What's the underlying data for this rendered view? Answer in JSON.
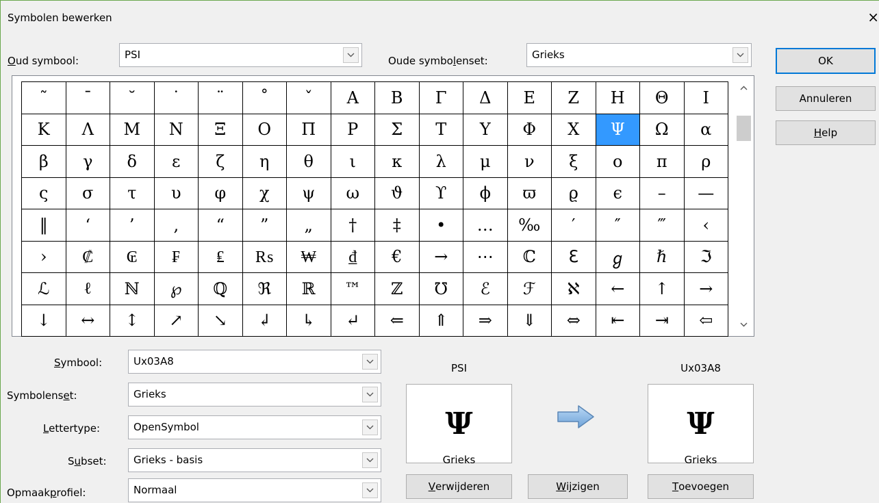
{
  "window": {
    "title": "Symbolen bewerken",
    "close_glyph": "×"
  },
  "old_symbol": {
    "label_u": "O",
    "label_rest": "ud symbool:",
    "value": "PSI"
  },
  "old_set": {
    "label_pre": "Oude symbo",
    "label_u": "l",
    "label_rest": "enset:",
    "value": "Grieks"
  },
  "buttons": {
    "ok": "OK",
    "cancel": "Annuleren",
    "help_u": "H",
    "help_rest": "elp",
    "delete_u": "V",
    "delete_rest": "erwijderen",
    "modify_u": "W",
    "modify_rest": "ijzigen",
    "add_u": "T",
    "add_rest": "oevoegen"
  },
  "grid": {
    "columns": 16,
    "selected_index": 29,
    "cells": [
      "˜",
      "¯",
      "˘",
      "˙",
      "¨",
      "˚",
      "ˇ",
      "Α",
      "Β",
      "Γ",
      "Δ",
      "Ε",
      "Ζ",
      "Η",
      "Θ",
      "Ι",
      "Κ",
      "Λ",
      "Μ",
      "Ν",
      "Ξ",
      "Ο",
      "Π",
      "Ρ",
      "Σ",
      "Τ",
      "Υ",
      "Φ",
      "Χ",
      "Ψ",
      "Ω",
      "α",
      "β",
      "γ",
      "δ",
      "ε",
      "ζ",
      "η",
      "θ",
      "ι",
      "κ",
      "λ",
      "μ",
      "ν",
      "ξ",
      "ο",
      "π",
      "ρ",
      "ς",
      "σ",
      "τ",
      "υ",
      "φ",
      "χ",
      "ψ",
      "ω",
      "ϑ",
      "ϒ",
      "ϕ",
      "ϖ",
      "ϱ",
      "ϵ",
      "–",
      "—",
      "‖",
      "‘",
      "’",
      "‚",
      "“",
      "”",
      "„",
      "†",
      "‡",
      "•",
      "…",
      "‰",
      "′",
      "″",
      "‴",
      "‹",
      "›",
      "₡",
      "₢",
      "₣",
      "₤",
      "₨",
      "₩",
      "₫",
      "€",
      "→",
      "⋯",
      "ℂ",
      "ℇ",
      "ℊ",
      "ℏ",
      "ℑ",
      "ℒ",
      "ℓ",
      "ℕ",
      "℘",
      "ℚ",
      "ℜ",
      "ℝ",
      "™",
      "ℤ",
      "℧",
      "ℰ",
      "ℱ",
      "ℵ",
      "←",
      "↑",
      "→",
      "↓",
      "↔",
      "↕",
      "↗",
      "↘",
      "↲",
      "↳",
      "↵",
      "⇐",
      "⇑",
      "⇒",
      "⇓",
      "⇔",
      "⇤",
      "⇥",
      "⇦"
    ]
  },
  "fields": {
    "symbol": {
      "label_u": "S",
      "label_rest": "ymbool:",
      "value": "Ux03A8"
    },
    "symbolset": {
      "label_pre": "Symbolens",
      "label_u": "e",
      "label_rest": "t:",
      "value": "Grieks"
    },
    "font": {
      "label_u": "L",
      "label_rest": "ettertype:",
      "value": "OpenSymbol"
    },
    "subset": {
      "label_pre": "S",
      "label_u": "u",
      "label_rest": "bset:",
      "value": "Grieks - basis"
    },
    "style": {
      "label_pre": "Opmaak",
      "label_u": "p",
      "label_rest": "rofiel:",
      "value": "Normaal"
    }
  },
  "preview": {
    "old_name": "PSI",
    "old_glyph": "Ψ",
    "old_set": "Grieks",
    "new_name": "Ux03A8",
    "new_glyph": "Ψ",
    "new_set": "Grieks",
    "arrow_color": "#7fb2e5"
  }
}
